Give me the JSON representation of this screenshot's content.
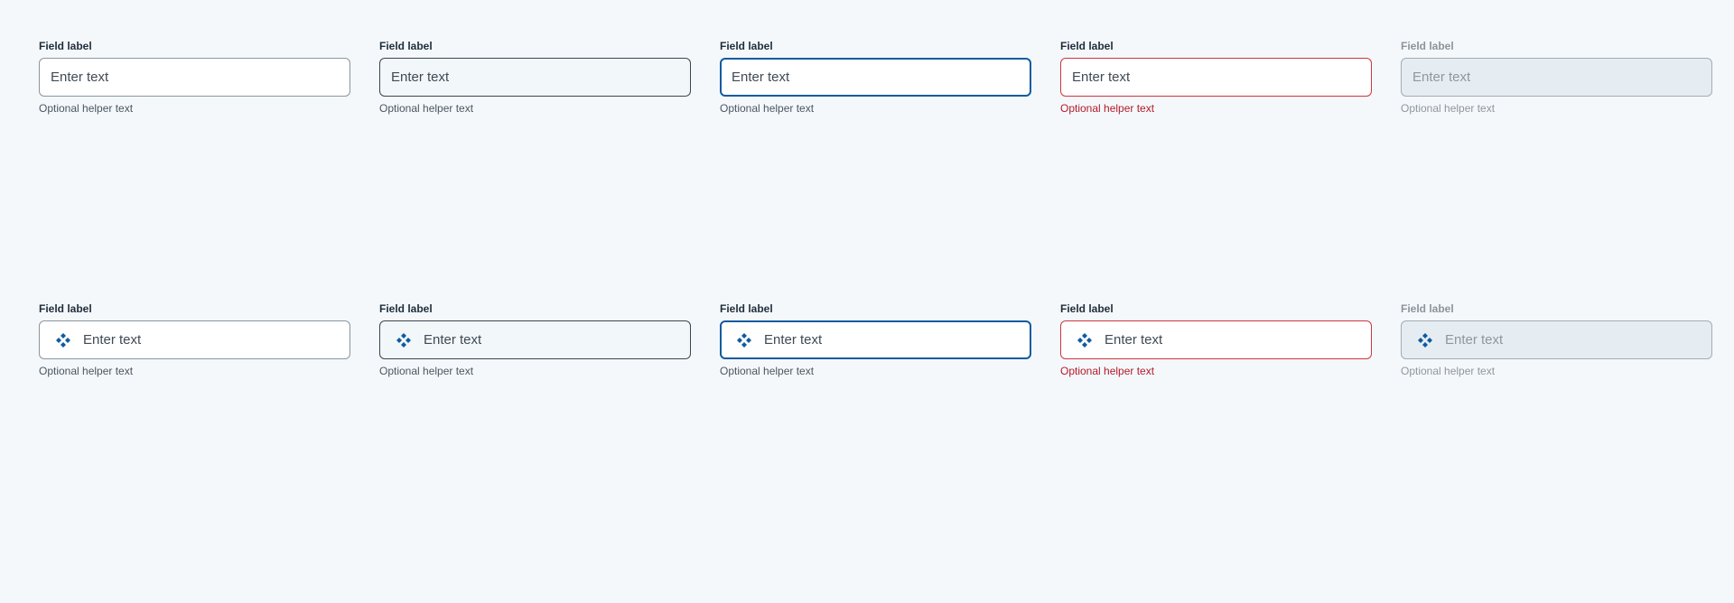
{
  "colors": {
    "background": "#f4f8fb",
    "focus_border": "#0f5ba0",
    "error_border": "#d0353f",
    "error_text": "#b31b2a",
    "icon": "#0f5ba0"
  },
  "rows": [
    {
      "icon": null,
      "fields": [
        {
          "state": "default",
          "label": "Field label",
          "placeholder": "Enter text",
          "helper": "Optional helper text"
        },
        {
          "state": "hover",
          "label": "Field label",
          "placeholder": "Enter text",
          "helper": "Optional helper text"
        },
        {
          "state": "focus",
          "label": "Field label",
          "placeholder": "Enter text",
          "helper": "Optional helper text"
        },
        {
          "state": "error",
          "label": "Field label",
          "placeholder": "Enter text",
          "helper": "Optional helper text"
        },
        {
          "state": "disabled",
          "label": "Field label",
          "placeholder": "Enter text",
          "helper": "Optional helper text"
        }
      ]
    },
    {
      "icon": "diamond-cluster-icon",
      "fields": [
        {
          "state": "default",
          "label": "Field label",
          "placeholder": "Enter text",
          "helper": "Optional helper text"
        },
        {
          "state": "hover",
          "label": "Field label",
          "placeholder": "Enter text",
          "helper": "Optional helper text"
        },
        {
          "state": "focus",
          "label": "Field label",
          "placeholder": "Enter text",
          "helper": "Optional helper text"
        },
        {
          "state": "error",
          "label": "Field label",
          "placeholder": "Enter text",
          "helper": "Optional helper text"
        },
        {
          "state": "disabled",
          "label": "Field label",
          "placeholder": "Enter text",
          "helper": "Optional helper text"
        }
      ]
    }
  ]
}
